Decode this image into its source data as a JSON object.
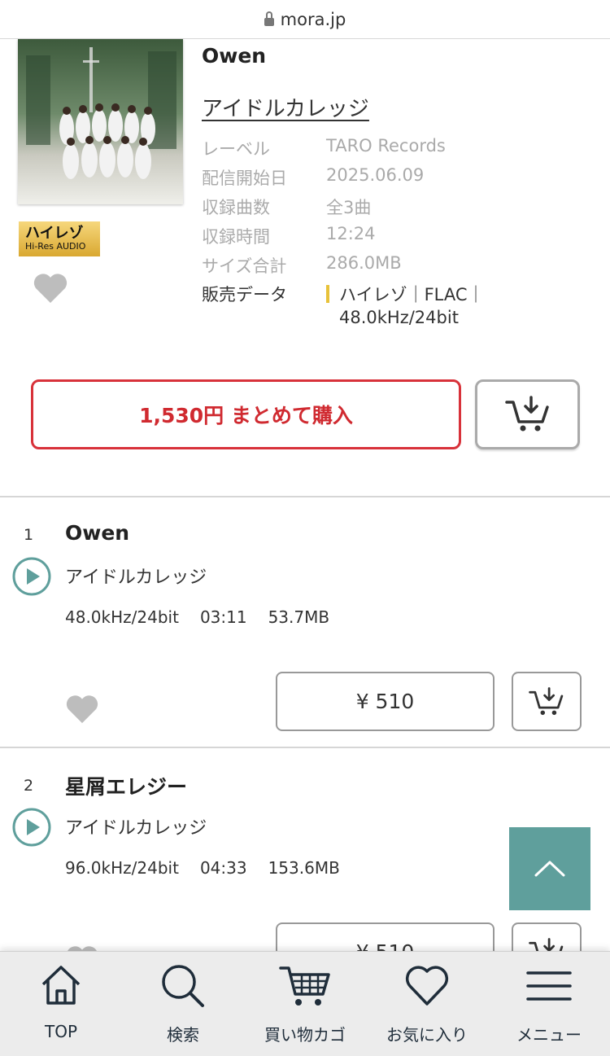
{
  "browser": {
    "url": "mora.jp"
  },
  "album": {
    "title": "Owen",
    "artist": "アイドルカレッジ",
    "badge": {
      "jp": "ハイレゾ",
      "en": "Hi-Res AUDIO"
    },
    "meta": [
      {
        "key": "レーベル",
        "value": "TARO Records"
      },
      {
        "key": "配信開始日",
        "value": "2025.06.09"
      },
      {
        "key": "収録曲数",
        "value": "全3曲"
      },
      {
        "key": "収録時間",
        "value": "12:24"
      },
      {
        "key": "サイズ合計",
        "value": "286.0MB"
      }
    ],
    "sales": {
      "key": "販売データ",
      "line1": "ハイレゾ｜FLAC｜",
      "line2": "48.0kHz/24bit"
    },
    "buy_all_label": "1,530円 まとめて購入"
  },
  "tracks": [
    {
      "num": "1",
      "title": "Owen",
      "artist": "アイドルカレッジ",
      "format": "48.0kHz/24bit",
      "duration": "03:11",
      "size": "53.7MB",
      "price": "¥ 510"
    },
    {
      "num": "2",
      "title": "星屑エレジー",
      "artist": "アイドルカレッジ",
      "format": "96.0kHz/24bit",
      "duration": "04:33",
      "size": "153.6MB",
      "price": "¥ 510"
    }
  ],
  "nav": [
    {
      "label": "TOP",
      "icon": "home-icon"
    },
    {
      "label": "検索",
      "icon": "search-icon"
    },
    {
      "label": "買い物カゴ",
      "icon": "cart-icon"
    },
    {
      "label": "お気に入り",
      "icon": "heart-outline-icon"
    },
    {
      "label": "メニュー",
      "icon": "hamburger-icon"
    }
  ],
  "colors": {
    "accent_red": "#d8323a",
    "teal": "#5f9f9c",
    "hires_gold": "#e8c23a"
  }
}
